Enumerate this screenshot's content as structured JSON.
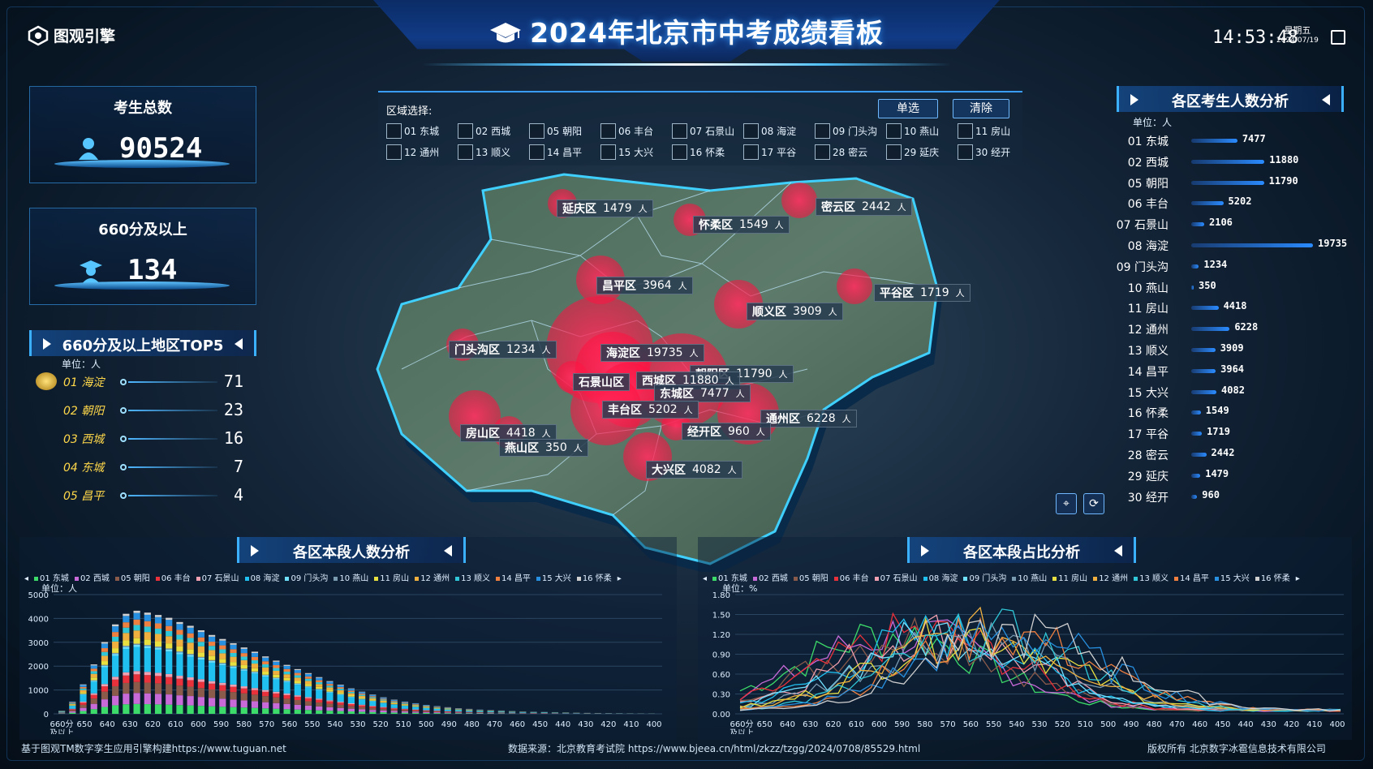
{
  "app": {
    "logo": "图观引擎",
    "title": "2024年北京市中考成绩看板",
    "time": "14:53:48",
    "weekday": "星期五",
    "date": "2024/07/19"
  },
  "stats": {
    "total": {
      "label": "考生总数",
      "value": "90524"
    },
    "high": {
      "label": "660分及以上",
      "value": "134"
    }
  },
  "top5": {
    "title": "660分及以上地区TOP5",
    "unit": "单位：人",
    "rows": [
      {
        "name": "01 海淀",
        "value": "71"
      },
      {
        "name": "02 朝阳",
        "value": "23"
      },
      {
        "name": "03 西城",
        "value": "16"
      },
      {
        "name": "04 东城",
        "value": "7"
      },
      {
        "name": "05 昌平",
        "value": "4"
      }
    ]
  },
  "region_select": {
    "label": "区域选择:",
    "single_btn": "单选",
    "clear_btn": "清除",
    "options": [
      "01 东城",
      "02 西城",
      "05 朝阳",
      "06 丰台",
      "07 石景山",
      "08 海淀",
      "09 门头沟",
      "10 燕山",
      "11 房山",
      "12 通州",
      "13 顺义",
      "14 昌平",
      "15 大兴",
      "16 怀柔",
      "17 平谷",
      "28 密云",
      "29 延庆",
      "30 经开"
    ]
  },
  "district_count": {
    "title": "各区考生人数分析",
    "unit": "单位：人",
    "max": 19735,
    "rows": [
      {
        "name": "01 东城",
        "value": 7477
      },
      {
        "name": "02 西城",
        "value": 11880
      },
      {
        "name": "05 朝阳",
        "value": 11790
      },
      {
        "name": "06 丰台",
        "value": 5202
      },
      {
        "name": "07 石景山",
        "value": 2106
      },
      {
        "name": "08 海淀",
        "value": 19735
      },
      {
        "name": "09 门头沟",
        "value": 1234
      },
      {
        "name": "10 燕山",
        "value": 350
      },
      {
        "name": "11 房山",
        "value": 4418
      },
      {
        "name": "12 通州",
        "value": 6228
      },
      {
        "name": "13 顺义",
        "value": 3909
      },
      {
        "name": "14 昌平",
        "value": 3964
      },
      {
        "name": "15 大兴",
        "value": 4082
      },
      {
        "name": "16 怀柔",
        "value": 1549
      },
      {
        "name": "17 平谷",
        "value": 1719
      },
      {
        "name": "28 密云",
        "value": 2442
      },
      {
        "name": "29 延庆",
        "value": 1479
      },
      {
        "name": "30 经开",
        "value": 960
      }
    ]
  },
  "map_labels": [
    {
      "name": "延庆区",
      "value": "1479",
      "unit": "人"
    },
    {
      "name": "怀柔区",
      "value": "1549",
      "unit": "人"
    },
    {
      "name": "密云区",
      "value": "2442",
      "unit": "人"
    },
    {
      "name": "昌平区",
      "value": "3964",
      "unit": "人"
    },
    {
      "name": "平谷区",
      "value": "1719",
      "unit": "人"
    },
    {
      "name": "顺义区",
      "value": "3909",
      "unit": "人"
    },
    {
      "name": "门头沟区",
      "value": "1234",
      "unit": "人"
    },
    {
      "name": "海淀区",
      "value": "19735",
      "unit": "人"
    },
    {
      "name": "朝阳区",
      "value": "11790",
      "unit": "人"
    },
    {
      "name": "石景山区",
      "value": "",
      "unit": ""
    },
    {
      "name": "西城区",
      "value": "11880",
      "unit": "人"
    },
    {
      "name": "东城区",
      "value": "7477",
      "unit": "人"
    },
    {
      "name": "丰台区",
      "value": "5202",
      "unit": "人"
    },
    {
      "name": "通州区",
      "value": "6228",
      "unit": "人"
    },
    {
      "name": "房山区",
      "value": "4418",
      "unit": "人"
    },
    {
      "name": "经开区",
      "value": "960",
      "unit": "人"
    },
    {
      "name": "燕山区",
      "value": "350",
      "unit": "人"
    },
    {
      "name": "大兴区",
      "value": "4082",
      "unit": "人"
    }
  ],
  "legend": [
    "01 东城",
    "02 西城",
    "05 朝阳",
    "06 丰台",
    "07 石景山",
    "08 海淀",
    "09 门头沟",
    "10 燕山",
    "11 房山",
    "12 通州",
    "13 顺义",
    "14 昌平",
    "15 大兴",
    "16 怀柔"
  ],
  "colors": {
    "series": [
      "#3ddc6a",
      "#c86ad8",
      "#8a5a4a",
      "#e8313a",
      "#f0a0b0",
      "#20c0f0",
      "#70e0ff",
      "#7a9ab0",
      "#e8e040",
      "#f0b040",
      "#30c8d8",
      "#f08040",
      "#2890e0",
      "#d0d0d0"
    ]
  },
  "chart_data": [
    {
      "type": "bar",
      "title": "各区本段人数分析",
      "ylabel": "单位：人",
      "ylim": [
        0,
        5000
      ],
      "yticks": [
        0,
        1000,
        2000,
        3000,
        4000,
        5000
      ],
      "x_tick_labels": [
        "660分及以上",
        "650",
        "640",
        "630",
        "620",
        "610",
        "600",
        "590",
        "580",
        "570",
        "560",
        "550",
        "540",
        "530",
        "520",
        "510",
        "500",
        "490",
        "480",
        "470",
        "460",
        "450",
        "440",
        "430",
        "420",
        "410",
        "400"
      ],
      "totals": [
        134,
        520,
        1250,
        2100,
        3050,
        3800,
        4250,
        4380,
        4300,
        4200,
        4080,
        3900,
        3740,
        3550,
        3350,
        3180,
        3000,
        2820,
        2640,
        2440,
        2260,
        2080,
        1900,
        1730,
        1560,
        1390,
        1240,
        1080,
        940,
        820,
        700,
        600,
        520,
        450,
        380,
        330,
        280,
        240,
        210,
        180,
        160,
        140,
        120,
        100,
        90,
        80,
        70,
        60,
        50,
        40,
        35,
        30,
        25,
        20,
        18,
        15
      ]
    },
    {
      "type": "line",
      "title": "各区本段占比分析",
      "ylabel": "单位：%",
      "ylim": [
        0,
        1.8
      ],
      "yticks": [
        "0.00",
        "0.30",
        "0.60",
        "0.90",
        "1.20",
        "1.50",
        "1.80"
      ],
      "x_tick_labels": [
        "660分及以上",
        "650",
        "640",
        "630",
        "620",
        "610",
        "600",
        "590",
        "580",
        "570",
        "560",
        "550",
        "540",
        "530",
        "520",
        "510",
        "500",
        "490",
        "480",
        "470",
        "460",
        "450",
        "440",
        "430",
        "420",
        "410",
        "400"
      ]
    }
  ],
  "footer": {
    "left": "基于图观TM数字孪生应用引擎构建https://www.tuguan.net",
    "center": "数据来源：北京教育考试院 https://www.bjeea.cn/html/zkzz/tzgg/2024/0708/85529.html",
    "right": "版权所有 北京数字冰雹信息技术有限公司"
  }
}
